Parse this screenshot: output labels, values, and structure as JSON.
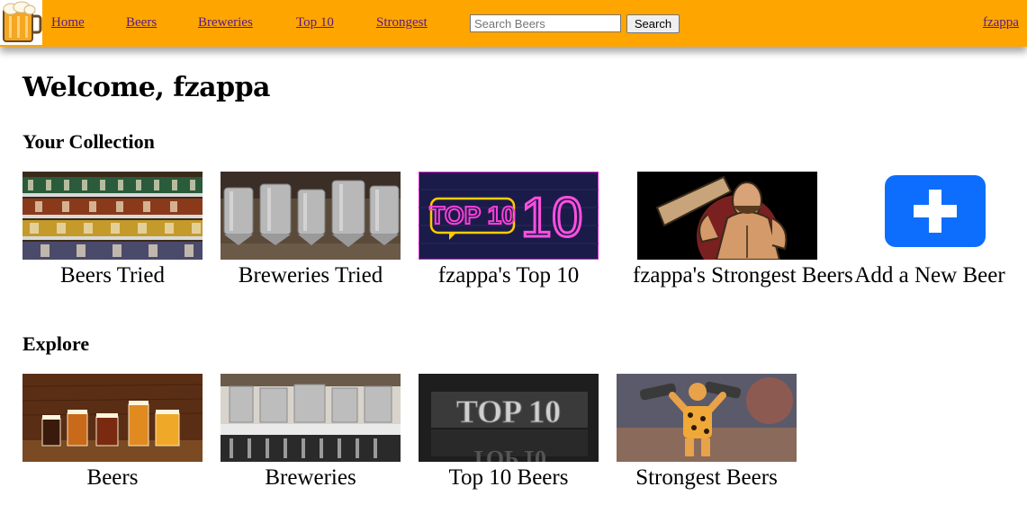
{
  "nav": {
    "links": [
      "Home",
      "Beers",
      "Breweries",
      "Top 10",
      "Strongest"
    ],
    "search_placeholder": "Search Beers",
    "search_button": "Search",
    "user": "fzappa"
  },
  "welcome": "Welcome, fzappa",
  "collection": {
    "title": "Your Collection",
    "items": [
      "Beers Tried",
      "Breweries Tried",
      "fzappa's Top 10",
      "fzappa's Strongest Beers",
      "Add a New Beer"
    ]
  },
  "explore": {
    "title": "Explore",
    "items": [
      "Beers",
      "Breweries",
      "Top 10 Beers",
      "Strongest Beers"
    ]
  },
  "images": {
    "collection_top10_text": "TOP 10",
    "explore_top10_text": "TOP 10"
  },
  "colors": {
    "nav_bar": "#ffa500",
    "link": "#551a8b",
    "add_button": "#0d6efd"
  },
  "icons": {
    "logo": "beer-mug-logo",
    "add": "plus-icon"
  }
}
